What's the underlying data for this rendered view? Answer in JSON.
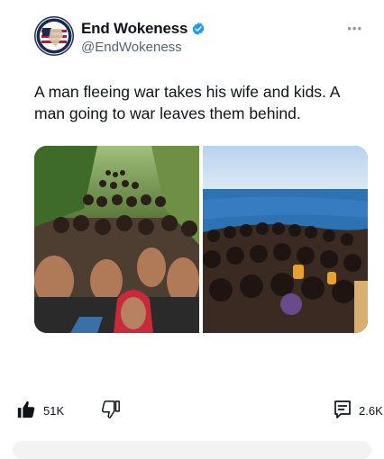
{
  "post": {
    "author": {
      "display_name": "End Wokeness",
      "handle": "@EndWokeness",
      "verified": true,
      "avatar_icon": "flag-seal-logo",
      "avatar_text": "I SUPPORT THE ARMED FORCES"
    },
    "more_icon": "ellipsis-icon",
    "text": "A man fleeing war takes his wife and kids. A man going to war leaves them behind.",
    "media": [
      {
        "icon": "photo-crowd-street"
      },
      {
        "icon": "photo-crowded-boat-sea"
      }
    ]
  },
  "actions": {
    "likes": "51K",
    "like_icon": "thumbs-up-icon",
    "dislike_icon": "thumbs-down-icon",
    "comments": "2.6K",
    "comment_icon": "comment-icon"
  },
  "colors": {
    "verified_blue": "#1d9bf0",
    "text": "#0f1419",
    "secondary_text": "#536471"
  }
}
